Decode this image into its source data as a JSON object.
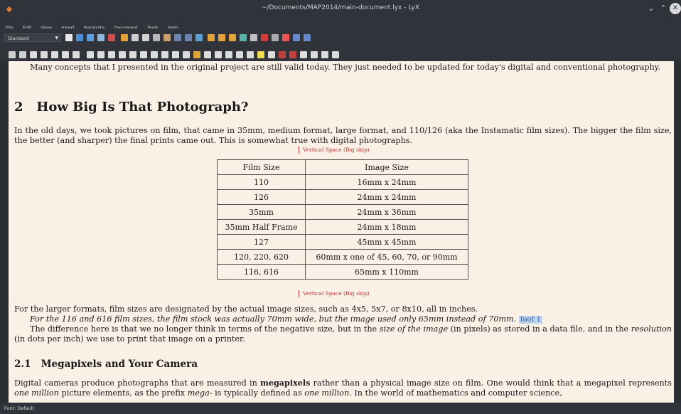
{
  "window": {
    "title": "~/Documents/MAP2014/main-document.lyx - LyX"
  },
  "menu": [
    "File",
    "Edit",
    "View",
    "Insert",
    "Navigate",
    "Document",
    "Tools",
    "Help"
  ],
  "toolbar": {
    "layout_combo": "Standard"
  },
  "doc": {
    "intro_line1": "Many concepts that I presented in the original project are still valid today. They just needed to be updated for today's digital and conventional",
    "intro_line2": "photography.",
    "sec_num": "2",
    "sec_title": "How Big Is That Photograph?",
    "para1_line1": "In the old days, we took pictures on film, that came in 35mm, medium format, large format, and 110/126 (aka the Instamatic film sizes). The bigger",
    "para1_line2": "the film size, the better (and sharper) the final prints came out. This is somewhat true with digital photographs.",
    "vspace_label": "Vertical Space (Big skip)",
    "table": {
      "headers": [
        "Film Size",
        "Image Size"
      ],
      "rows": [
        [
          "110",
          "16mm x 24mm"
        ],
        [
          "126",
          "24mm x 24mm"
        ],
        [
          "35mm",
          "24mm x 36mm"
        ],
        [
          "35mm Half Frame",
          "24mm x 18mm"
        ],
        [
          "127",
          "45mm x 45mm"
        ],
        [
          "120, 220, 620",
          "60mm x one of 45, 60, 70, or 90mm"
        ],
        [
          "116, 616",
          "65mm x 110mm"
        ]
      ]
    },
    "para2": "For the larger formats, film sizes are designated by the actual image sizes, such as 4x5, 5x7, or 8x10, all in inches.",
    "para3": "For the 116 and 616 film sizes, the film stock was actually 70mm wide, but the image used only 65mm instead of 70mm.",
    "foot_label": "foot 1",
    "para4_a": "The difference here is that we no longer think in terms of the negative size, but in the ",
    "para4_em": "size of the image",
    "para4_b": " (in pixels) as stored in a data file, and in",
    "para4_line2_a": "the ",
    "para4_line2_em": "resolution",
    "para4_line2_b": " (in dots per inch) we use to print that image on a printer.",
    "subsec_num": "2.1",
    "subsec_title": "Megapixels and Your Camera",
    "para5_line1_a": "Digital cameras produce photographs that are measured in ",
    "para5_line1_b": "megapixels",
    "para5_line1_c": " rather than a physical image size on film. One would think that a megapixel",
    "para5_line2_a": "represents ",
    "para5_line2_em1": "one million",
    "para5_line2_b": " picture elements, as the prefix ",
    "para5_line2_em2": "mega-",
    "para5_line2_c": " is typically defined as ",
    "para5_line2_em3": "one million",
    "para5_line2_d": ". In the world of mathematics and computer science,"
  },
  "status": "Font: Default"
}
